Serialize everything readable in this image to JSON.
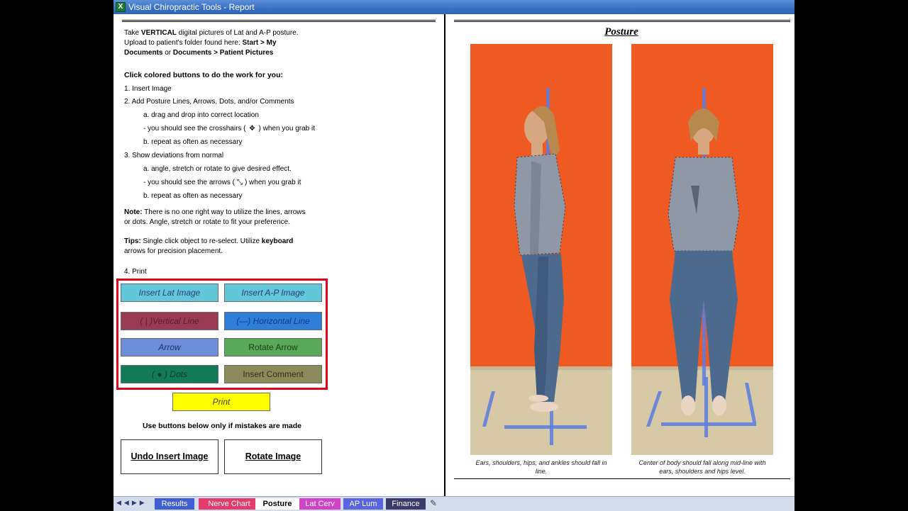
{
  "window": {
    "title": "Visual Chiropractic Tools - Report"
  },
  "instructions": {
    "intro_1a": "Take ",
    "intro_1b": "VERTICAL",
    "intro_1c": " digital pictures of Lat and A-P posture.",
    "intro_2a": "Upload to patient's folder found here: ",
    "intro_2b": "Start > My",
    "intro_3a": "Documents",
    "intro_3b": " or ",
    "intro_3c": "Documents > Patient Pictures",
    "heading": "Click colored buttons to do the work for you:",
    "s1": "1. Insert Image",
    "s2": "2. Add Posture Lines, Arrows, Dots, and/or Comments",
    "s2a": "a. drag and drop into correct location",
    "s2b1": "- you should see the crosshairs (",
    "s2b2": ") when you grab it",
    "s2c": "b. repeat as often as necessary",
    "s3": "3. Show deviations from normal",
    "s3a": "a. angle, stretch or rotate to give desired effect.",
    "s3b1": "- you should see the arrows (",
    "s3b2": ") when you grab it",
    "s3c": "b. repeat as often as necessary",
    "note_label": "Note:",
    "note_1": " There is no one right way to utilize the lines, arrows",
    "note_2": "or dots.  Angle, stretch or rotate to fit your preference.",
    "tips_label": "Tips:",
    "tips_1a": "  Single click object to re-select.  Utilize ",
    "tips_1b": "keyboard",
    "tips_2": "arrows for precision placement.",
    "s4": "4. Print"
  },
  "buttons": {
    "insert_lat": "Insert Lat Image",
    "insert_ap": "Insert A-P Image",
    "vertical_line": "( | )Vertical Line",
    "horizontal_line": "(—) Horizontal Line",
    "arrow": "Arrow",
    "rotate_arrow": "Rotate Arrow",
    "dots": "( ● )  Dots",
    "insert_comment": "Insert Comment",
    "print": "Print",
    "mistakes_note": "Use buttons below only if mistakes are made",
    "undo_insert": "Undo Insert Image",
    "rotate_image": "Rotate Image"
  },
  "report": {
    "title": "Posture",
    "caption_lat": "Ears, shoulders, hips, and ankles should fall in line.",
    "caption_ap": "Center of body should fall along mid-line with ears, shoulders and hips level."
  },
  "sheet_tabs": [
    {
      "label": "Results",
      "active": false
    },
    {
      "label": "Nerve Chart",
      "active": false
    },
    {
      "label": "Posture",
      "active": true
    },
    {
      "label": "Lat Cerv",
      "active": false
    },
    {
      "label": "AP Lum",
      "active": false
    },
    {
      "label": "Finance",
      "active": false
    }
  ],
  "colors": {
    "accent_red": "#e0001b",
    "btn_cyan": "#62c8d9",
    "btn_maroon": "#9b3a55",
    "btn_blue": "#2f7ed8",
    "btn_periwinkle": "#6f8ed9",
    "btn_green": "#5aa85a",
    "btn_teal": "#137a57",
    "btn_olive": "#8a8a5a",
    "btn_yellow": "#ffff00"
  }
}
